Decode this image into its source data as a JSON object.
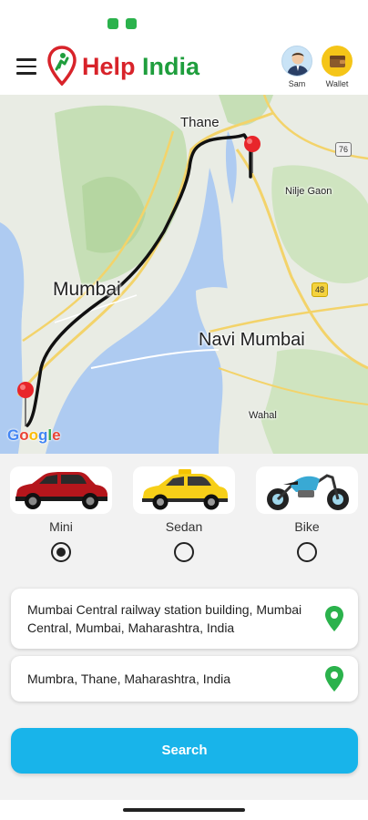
{
  "app": {
    "brand_part1": "Help",
    "brand_part2": "India",
    "profile_label": "Sam",
    "wallet_label": "Wallet"
  },
  "map": {
    "labels": {
      "thane": "Thane",
      "nilje": "Nilje Gaon",
      "mumbai": "Mumbai",
      "navi_mumbai": "Navi Mumbai",
      "wahal": "Wahal"
    },
    "shields": {
      "s76": "76",
      "s48": "48"
    },
    "attribution": "Google"
  },
  "vehicles": [
    {
      "name": "Mini",
      "selected": true,
      "icon": "car-icon"
    },
    {
      "name": "Sedan",
      "selected": false,
      "icon": "taxi-icon"
    },
    {
      "name": "Bike",
      "selected": false,
      "icon": "motorbike-icon"
    }
  ],
  "pickup": {
    "address": "Mumbai Central railway station building, Mumbai Central, Mumbai, Maharashtra, India"
  },
  "destination": {
    "address": "Mumbra, Thane, Maharashtra, India"
  },
  "search": {
    "label": "Search"
  },
  "colors": {
    "brand_red": "#d8232a",
    "brand_green": "#1f9e3d",
    "search_button": "#18b4ea",
    "location_pin": "#2bb24c",
    "route": "#111111",
    "marker": "#e8262b"
  }
}
